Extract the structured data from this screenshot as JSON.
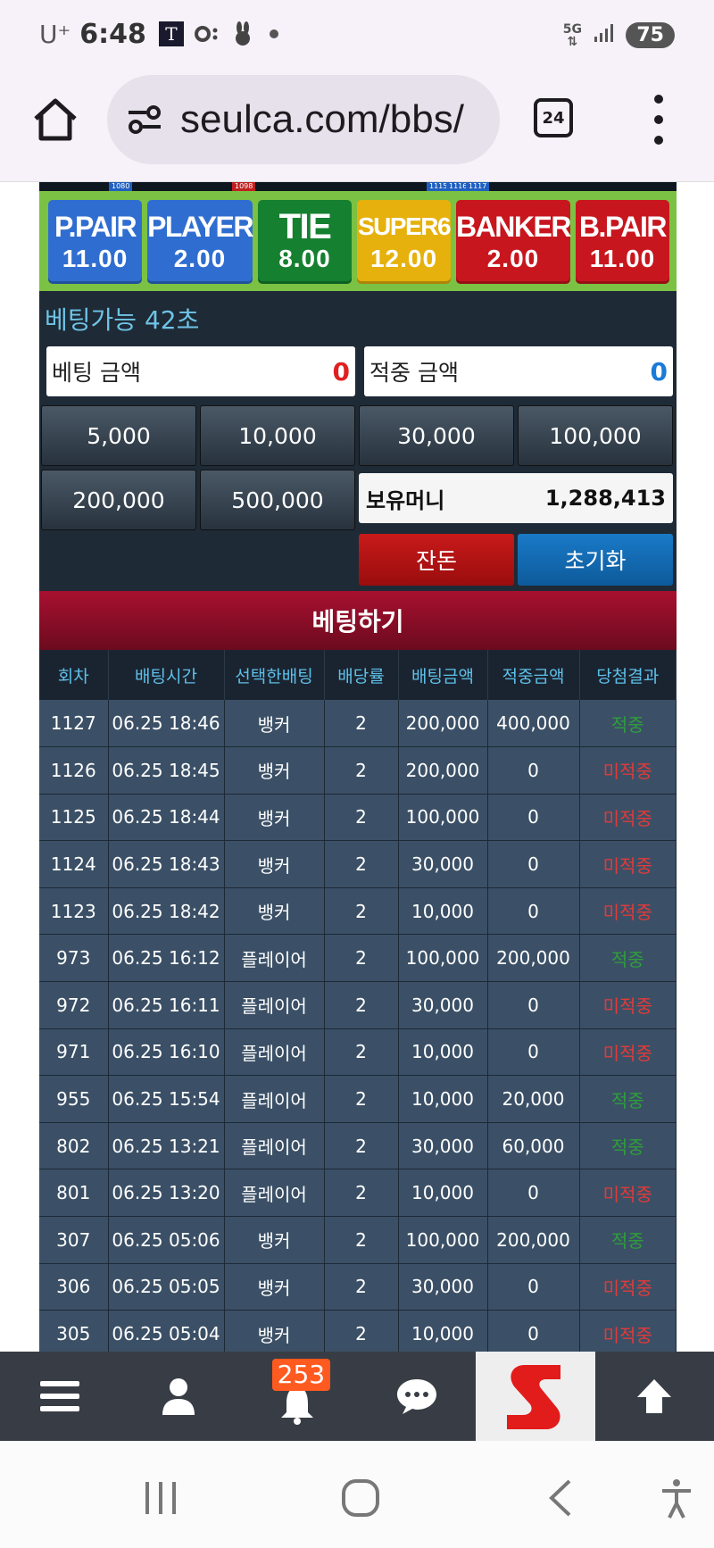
{
  "status_bar": {
    "carrier": "U⁺",
    "time": "6:48",
    "t_icon": "T",
    "icons": [
      "t-app-icon",
      "mail-icon",
      "rabbit-icon",
      "dot-icon"
    ],
    "network": "5G",
    "battery": "75"
  },
  "browser": {
    "url": "seulca.com/bbs/",
    "tab_count": "24"
  },
  "ticker": [
    "1080",
    "1098",
    "1115",
    "1116",
    "1117"
  ],
  "bet_options": [
    {
      "name": "P.PAIR",
      "odds": "11.00",
      "color": "#2f6ed0"
    },
    {
      "name": "PLAYER",
      "odds": "2.00",
      "color": "#2f6ed0"
    },
    {
      "name": "TIE",
      "odds": "8.00",
      "color": "#15802f"
    },
    {
      "name": "SUPER6",
      "odds": "12.00",
      "color": "#e6b10c"
    },
    {
      "name": "BANKER",
      "odds": "2.00",
      "color": "#c8161e"
    },
    {
      "name": "B.PAIR",
      "odds": "11.00",
      "color": "#c8161e"
    }
  ],
  "betting": {
    "available_label": "베팅가능 42초",
    "bet_amount_label": "베팅 금액",
    "bet_amount_value": "0",
    "win_amount_label": "적중 금액",
    "win_amount_value": "0",
    "chips": [
      "5,000",
      "10,000",
      "30,000",
      "100,000",
      "200,000",
      "500,000"
    ],
    "money_label": "보유머니",
    "money_value": "1,288,413",
    "change_label": "잔돈",
    "reset_label": "초기화",
    "submit_label": "베팅하기"
  },
  "history": {
    "headers": [
      "회차",
      "배팅시간",
      "선택한배팅",
      "배당률",
      "배팅금액",
      "적중금액",
      "당첨결과"
    ],
    "rows": [
      [
        "1127",
        "06.25 18:46",
        "뱅커",
        "2",
        "200,000",
        "400,000",
        "적중"
      ],
      [
        "1126",
        "06.25 18:45",
        "뱅커",
        "2",
        "200,000",
        "0",
        "미적중"
      ],
      [
        "1125",
        "06.25 18:44",
        "뱅커",
        "2",
        "100,000",
        "0",
        "미적중"
      ],
      [
        "1124",
        "06.25 18:43",
        "뱅커",
        "2",
        "30,000",
        "0",
        "미적중"
      ],
      [
        "1123",
        "06.25 18:42",
        "뱅커",
        "2",
        "10,000",
        "0",
        "미적중"
      ],
      [
        "973",
        "06.25 16:12",
        "플레이어",
        "2",
        "100,000",
        "200,000",
        "적중"
      ],
      [
        "972",
        "06.25 16:11",
        "플레이어",
        "2",
        "30,000",
        "0",
        "미적중"
      ],
      [
        "971",
        "06.25 16:10",
        "플레이어",
        "2",
        "10,000",
        "0",
        "미적중"
      ],
      [
        "955",
        "06.25 15:54",
        "플레이어",
        "2",
        "10,000",
        "20,000",
        "적중"
      ],
      [
        "802",
        "06.25 13:21",
        "플레이어",
        "2",
        "30,000",
        "60,000",
        "적중"
      ],
      [
        "801",
        "06.25 13:20",
        "플레이어",
        "2",
        "10,000",
        "0",
        "미적중"
      ],
      [
        "307",
        "06.25 05:06",
        "뱅커",
        "2",
        "100,000",
        "200,000",
        "적중"
      ],
      [
        "306",
        "06.25 05:05",
        "뱅커",
        "2",
        "30,000",
        "0",
        "미적중"
      ],
      [
        "305",
        "06.25 05:04",
        "뱅커",
        "2",
        "10,000",
        "0",
        "미적중"
      ]
    ],
    "win_color": "#2e9e3a",
    "lose_color": "#e23a3a"
  },
  "bottom_nav": {
    "items": [
      "menu-icon",
      "user-icon",
      "bell-icon",
      "chat-icon",
      "site-logo",
      "arrow-up-icon"
    ],
    "notification_count": "253"
  },
  "system_nav": [
    "recent-apps-icon",
    "home-circle-icon",
    "back-icon",
    "accessibility-icon"
  ]
}
